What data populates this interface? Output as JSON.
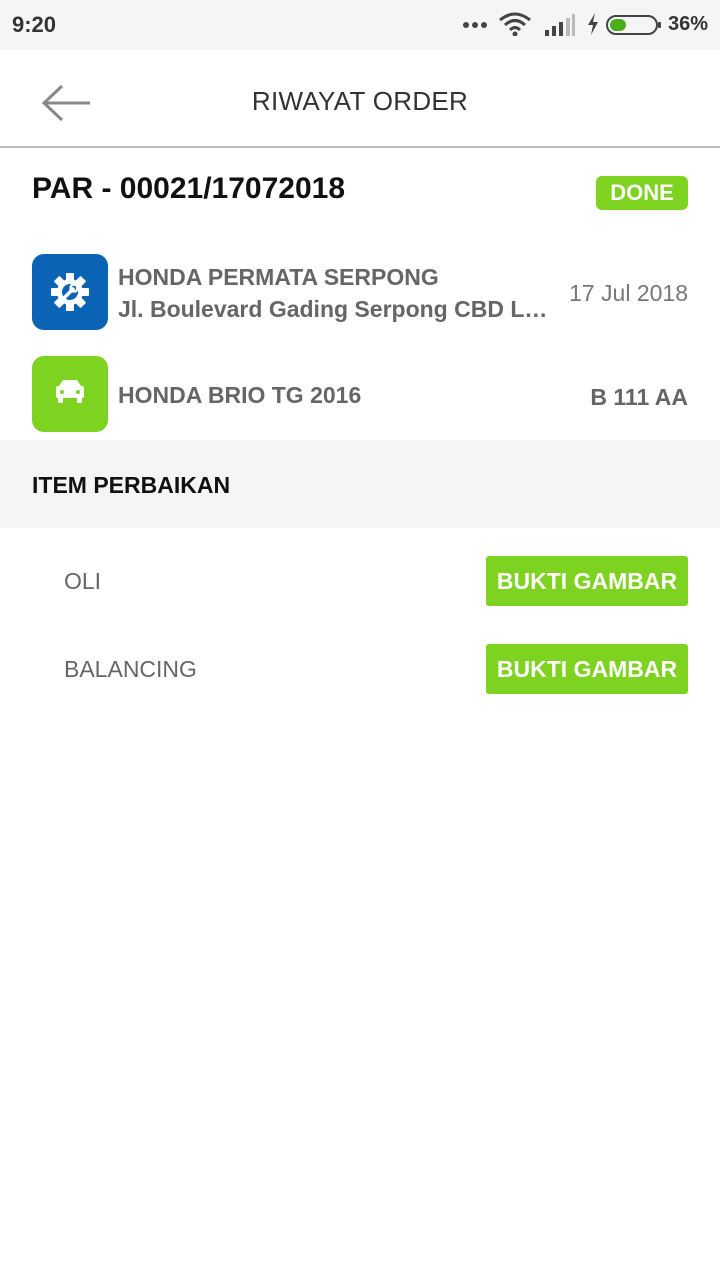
{
  "status_bar": {
    "time": "9:20",
    "battery_percent": "36%",
    "battery_level": 0.36,
    "icons": [
      "more-dots-icon",
      "wifi-icon",
      "signal-icon",
      "charging-bolt-icon",
      "battery-icon"
    ]
  },
  "toolbar": {
    "title": "RIWAYAT ORDER",
    "back_icon": "arrow-left-icon"
  },
  "order": {
    "id": "PAR - 00021/17072018",
    "status": "DONE"
  },
  "workshop": {
    "icon": "gear-wrench-icon",
    "name": "HONDA PERMATA SERPONG",
    "address": "Jl. Boulevard Gading Serpong CBD Lot. ...",
    "date": "17 Jul 2018"
  },
  "car": {
    "icon": "car-icon",
    "name": "HONDA BRIO TG 2016",
    "plate": "B 111 AA"
  },
  "repair_section": {
    "title": "ITEM PERBAIKAN",
    "items": [
      {
        "label": "OLI",
        "button": "BUKTI GAMBAR"
      },
      {
        "label": "BALANCING",
        "button": "BUKTI GAMBAR"
      }
    ]
  },
  "colors": {
    "accent_green": "#7ed321",
    "workshop_blue": "#0a63b5",
    "section_bg": "#f5f5f5"
  }
}
